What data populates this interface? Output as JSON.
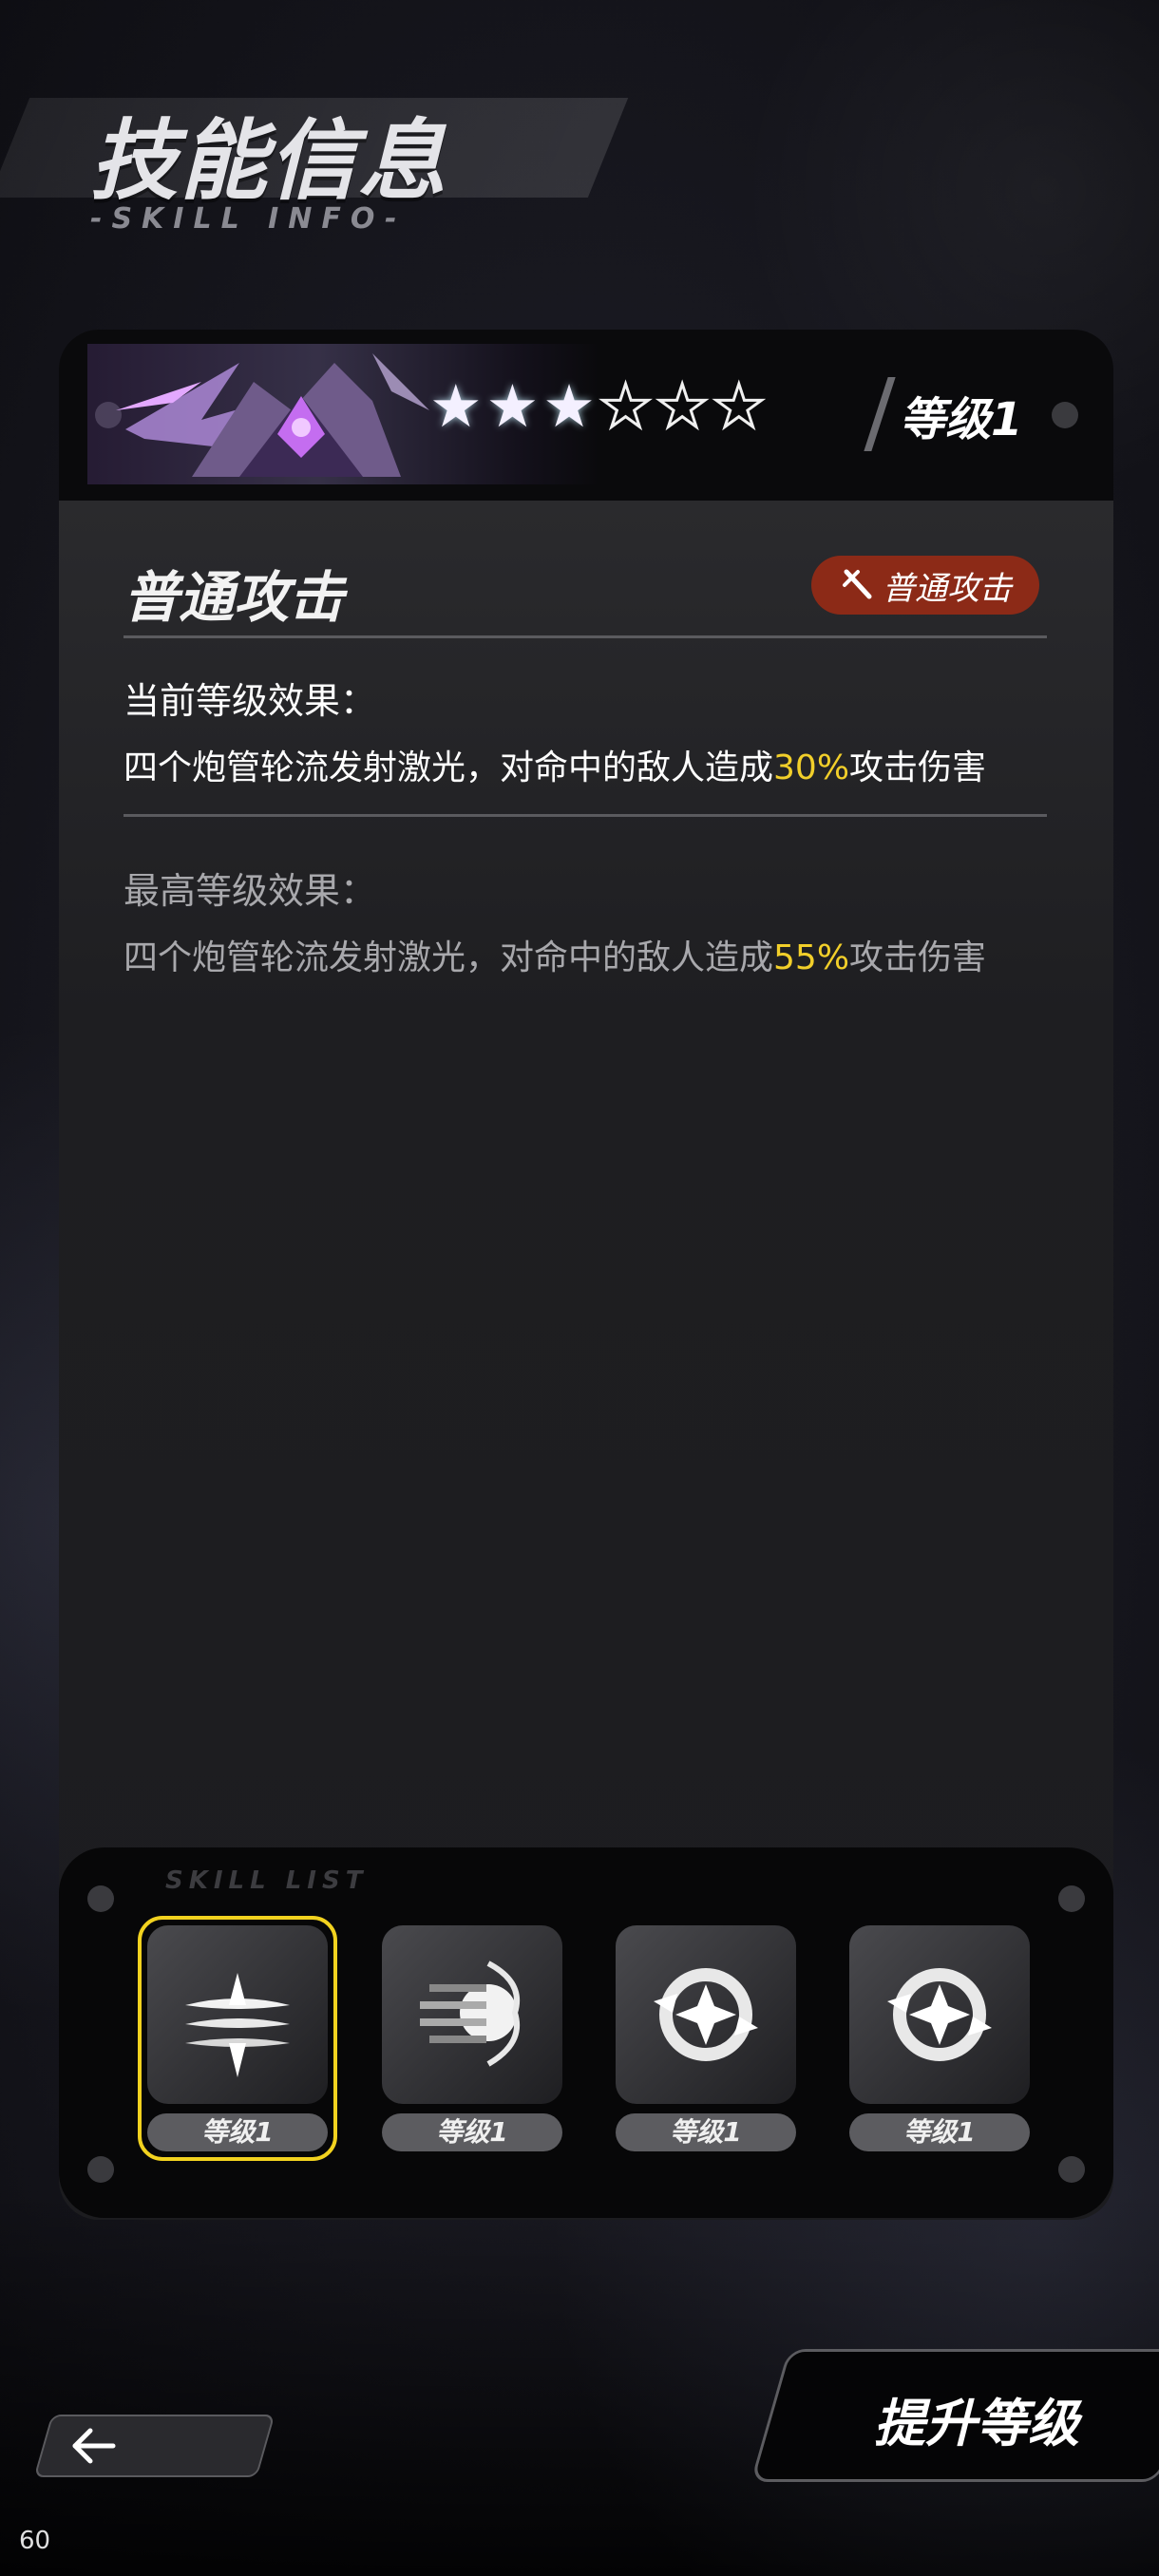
{
  "header": {
    "title": "技能信息",
    "subtitle": "-SKILL INFO-"
  },
  "card": {
    "stars": {
      "filled": 3,
      "total": 6
    },
    "level_label": "等级1",
    "skill_name": "普通攻击",
    "type_badge": {
      "icon": "sword-icon",
      "label": "普通攻击",
      "color": "#8c2a17"
    },
    "current_effect": {
      "title": "当前等级效果：",
      "text_prefix": "四个炮管轮流发射激光，对命中的敌人造成",
      "value": "30%",
      "text_suffix": "攻击伤害"
    },
    "max_effect": {
      "title": "最高等级效果：",
      "text_prefix": "四个炮管轮流发射激光，对命中的敌人造成",
      "value": "55%",
      "text_suffix": "攻击伤害"
    }
  },
  "skills_bar": {
    "label": "SKILL LIST",
    "skills": [
      {
        "icon": "triple-blade-icon",
        "level_label": "等级1",
        "selected": true
      },
      {
        "icon": "cannon-burst-icon",
        "level_label": "等级1",
        "selected": false
      },
      {
        "icon": "crosshair-star-icon",
        "level_label": "等级1",
        "selected": false
      },
      {
        "icon": "crosshair-star-icon",
        "level_label": "等级1",
        "selected": false
      }
    ]
  },
  "actions": {
    "upgrade_label": "提升等级",
    "back_icon": "arrow-left-icon"
  },
  "status": {
    "fps": "60"
  },
  "colors": {
    "highlight": "#f2cf2a",
    "badge": "#8c2a17",
    "selected_border": "#f2d21f"
  }
}
